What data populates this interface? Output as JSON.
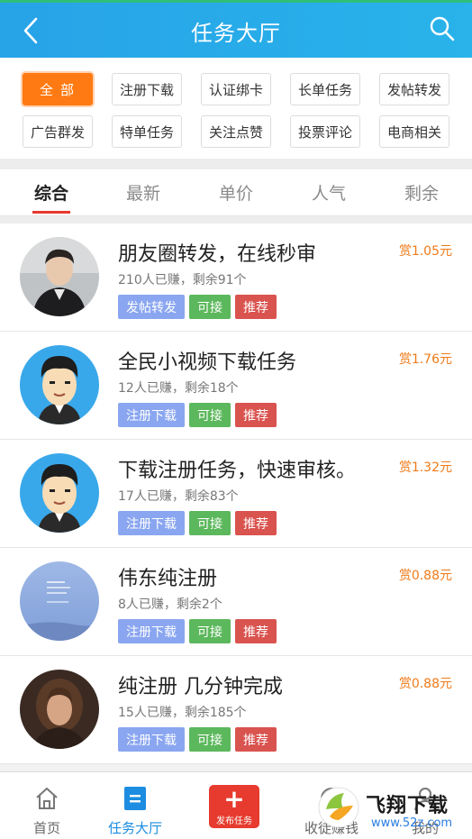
{
  "header": {
    "title": "任务大厅"
  },
  "filters": [
    "全部",
    "注册下载",
    "认证绑卡",
    "长单任务",
    "发帖转发",
    "广告群发",
    "特单任务",
    "关注点赞",
    "投票评论",
    "电商相关"
  ],
  "sort_tabs": [
    "综合",
    "最新",
    "单价",
    "人气",
    "剩余"
  ],
  "tasks": [
    {
      "title": "朋友圈转发，在线秒审",
      "stats": "210人已赚，剩余91个",
      "reward": "赏1.05元",
      "tags": [
        "发帖转发",
        "可接",
        "推荐"
      ]
    },
    {
      "title": "全民小视频下载任务",
      "stats": "12人已赚，剩余18个",
      "reward": "赏1.76元",
      "tags": [
        "注册下载",
        "可接",
        "推荐"
      ]
    },
    {
      "title": "下载注册任务，快速审核。",
      "stats": "17人已赚，剩余83个",
      "reward": "赏1.32元",
      "tags": [
        "注册下载",
        "可接",
        "推荐"
      ]
    },
    {
      "title": "伟东纯注册",
      "stats": "8人已赚，剩余2个",
      "reward": "赏0.88元",
      "tags": [
        "注册下载",
        "可接",
        "推荐"
      ]
    },
    {
      "title": "纯注册 几分钟完成",
      "stats": "15人已赚，剩余185个",
      "reward": "赏0.88元",
      "tags": [
        "注册下载",
        "可接",
        "推荐"
      ]
    }
  ],
  "bottom_nav": {
    "home": "首页",
    "hall": "任务大厅",
    "publish": "发布任务",
    "earn": "收徒赚钱",
    "mine": "我的"
  },
  "watermark": {
    "text": "飞翔下载",
    "url": "www.52z.com"
  },
  "colors": {
    "header": "#27a3e8",
    "accent_orange": "#ff7a12",
    "reward": "#f07a18",
    "tag_category": "#8aa6f0",
    "tag_ok": "#5cb85c",
    "tag_recommend": "#d9534f",
    "nav_active": "#1c8de0",
    "publish": "#e63b2e"
  }
}
